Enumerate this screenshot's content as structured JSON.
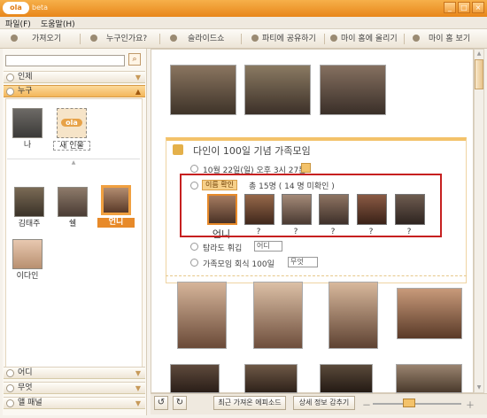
{
  "app": {
    "logo": "ola log",
    "edition": "beta"
  },
  "window_controls": {
    "minimize": "_",
    "maximize": "□",
    "close": "×"
  },
  "menu": {
    "file": "파일(F)",
    "help": "도움말(H)"
  },
  "toolbar": {
    "import": "가져오기",
    "who": "누구인가요?",
    "slideshow": "슬라이드쇼",
    "share": "파티에 공유하기",
    "upload": "마이 홈에 올리기",
    "view_home": "마이 홈 보기"
  },
  "sidebar": {
    "search_placeholder": "",
    "sections": {
      "person": "인제",
      "who": "누구",
      "where": "어디",
      "what": "무엇",
      "album": "앨 패널"
    },
    "people": [
      {
        "name": "나"
      },
      {
        "name": "새 인물",
        "logo": "ola"
      },
      {
        "name": "김태주"
      },
      {
        "name": "쉘"
      },
      {
        "name": "언니",
        "selected": true
      },
      {
        "name": "이다인"
      }
    ]
  },
  "event": {
    "title": "다인이 100일 기념 가족모임",
    "datetime": "10월 22일(일) 오후 3시 27분",
    "confirm_button": "이름 확인",
    "total": "총 15명 ( 14 명 미확인 )",
    "faces": [
      {
        "label": "언니"
      },
      {
        "label": "?"
      },
      {
        "label": "?"
      },
      {
        "label": "?"
      },
      {
        "label": "?"
      },
      {
        "label": "?"
      }
    ],
    "place_label": "탐라도 휘깁",
    "place_value": "어디",
    "what_label": "가족모임 회식 100일",
    "what_value": "무엇"
  },
  "statusbar": {
    "recent": "최근 가져온 에피소드",
    "hide_detail": "상세 정보 감추기"
  },
  "colors": {
    "titlebar": "#e8861a",
    "accent": "#f3c26a",
    "highlight": "#c62020"
  }
}
